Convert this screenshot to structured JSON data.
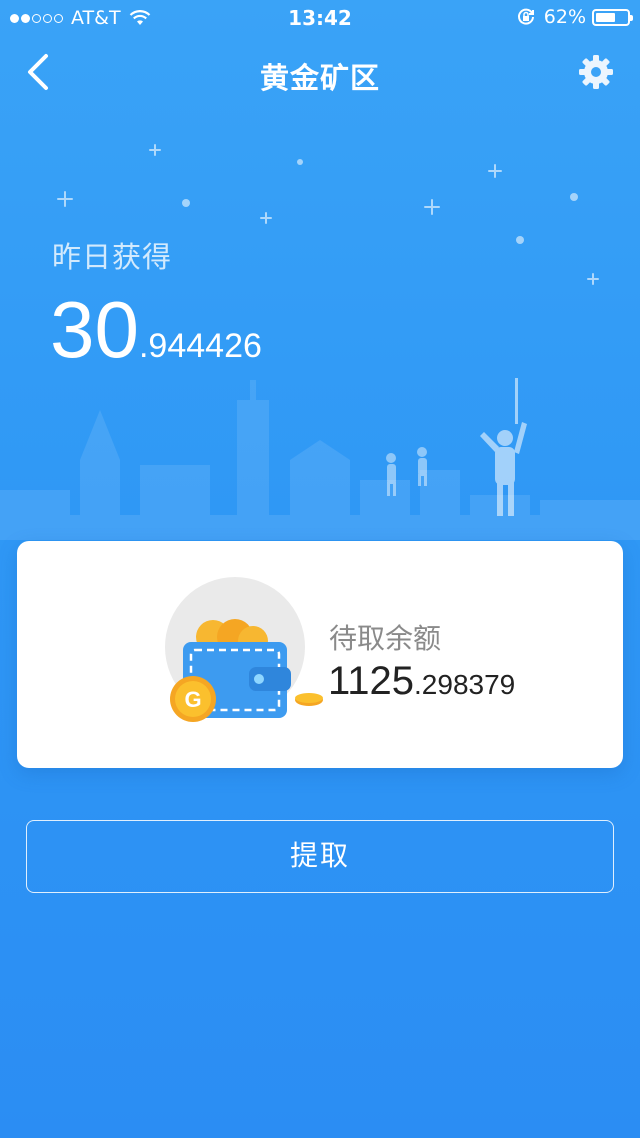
{
  "status_bar": {
    "carrier": "AT&T",
    "time": "13:42",
    "battery_percent": "62%",
    "battery_level": 0.62,
    "signal_bars_on": 2,
    "signal_bars_total": 5
  },
  "nav": {
    "title": "黄金矿区",
    "back_icon": "chevron-left-icon",
    "settings_icon": "gear-icon"
  },
  "yesterday": {
    "label": "昨日获得",
    "amount_integer": "30",
    "amount_decimal": ".944426"
  },
  "balance_card": {
    "label": "待取余额",
    "amount_integer": "1125",
    "amount_decimal": ".298379",
    "coin_letter": "G"
  },
  "actions": {
    "withdraw_label": "提取"
  },
  "colors": {
    "background_top": "#3aa3f7",
    "background_bottom": "#2b8df3",
    "card": "#ffffff",
    "wallet": "#3d9bf0",
    "coin": "#f7b731"
  }
}
